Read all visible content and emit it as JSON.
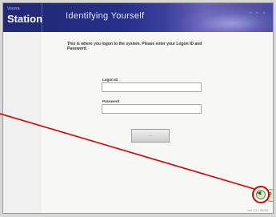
{
  "brand": {
    "small": "Vocera",
    "name": "Station"
  },
  "title": "Identifying Yourself",
  "header_icons": "◦ ◦ ◦",
  "instructions": "This is where you logon to the system. Please enter your Logon ID and Password.",
  "logon_id": {
    "label": "Logon ID",
    "value": ""
  },
  "password": {
    "label": "Password",
    "value": ""
  },
  "submit_label": "...",
  "help_icon_glyph": "?",
  "nav_icon_glyph": "◀",
  "footer": "ver 1.2 / 03.09",
  "colors": {
    "header": "#27308a",
    "highlight": "#d80000",
    "help": "#356b22"
  }
}
